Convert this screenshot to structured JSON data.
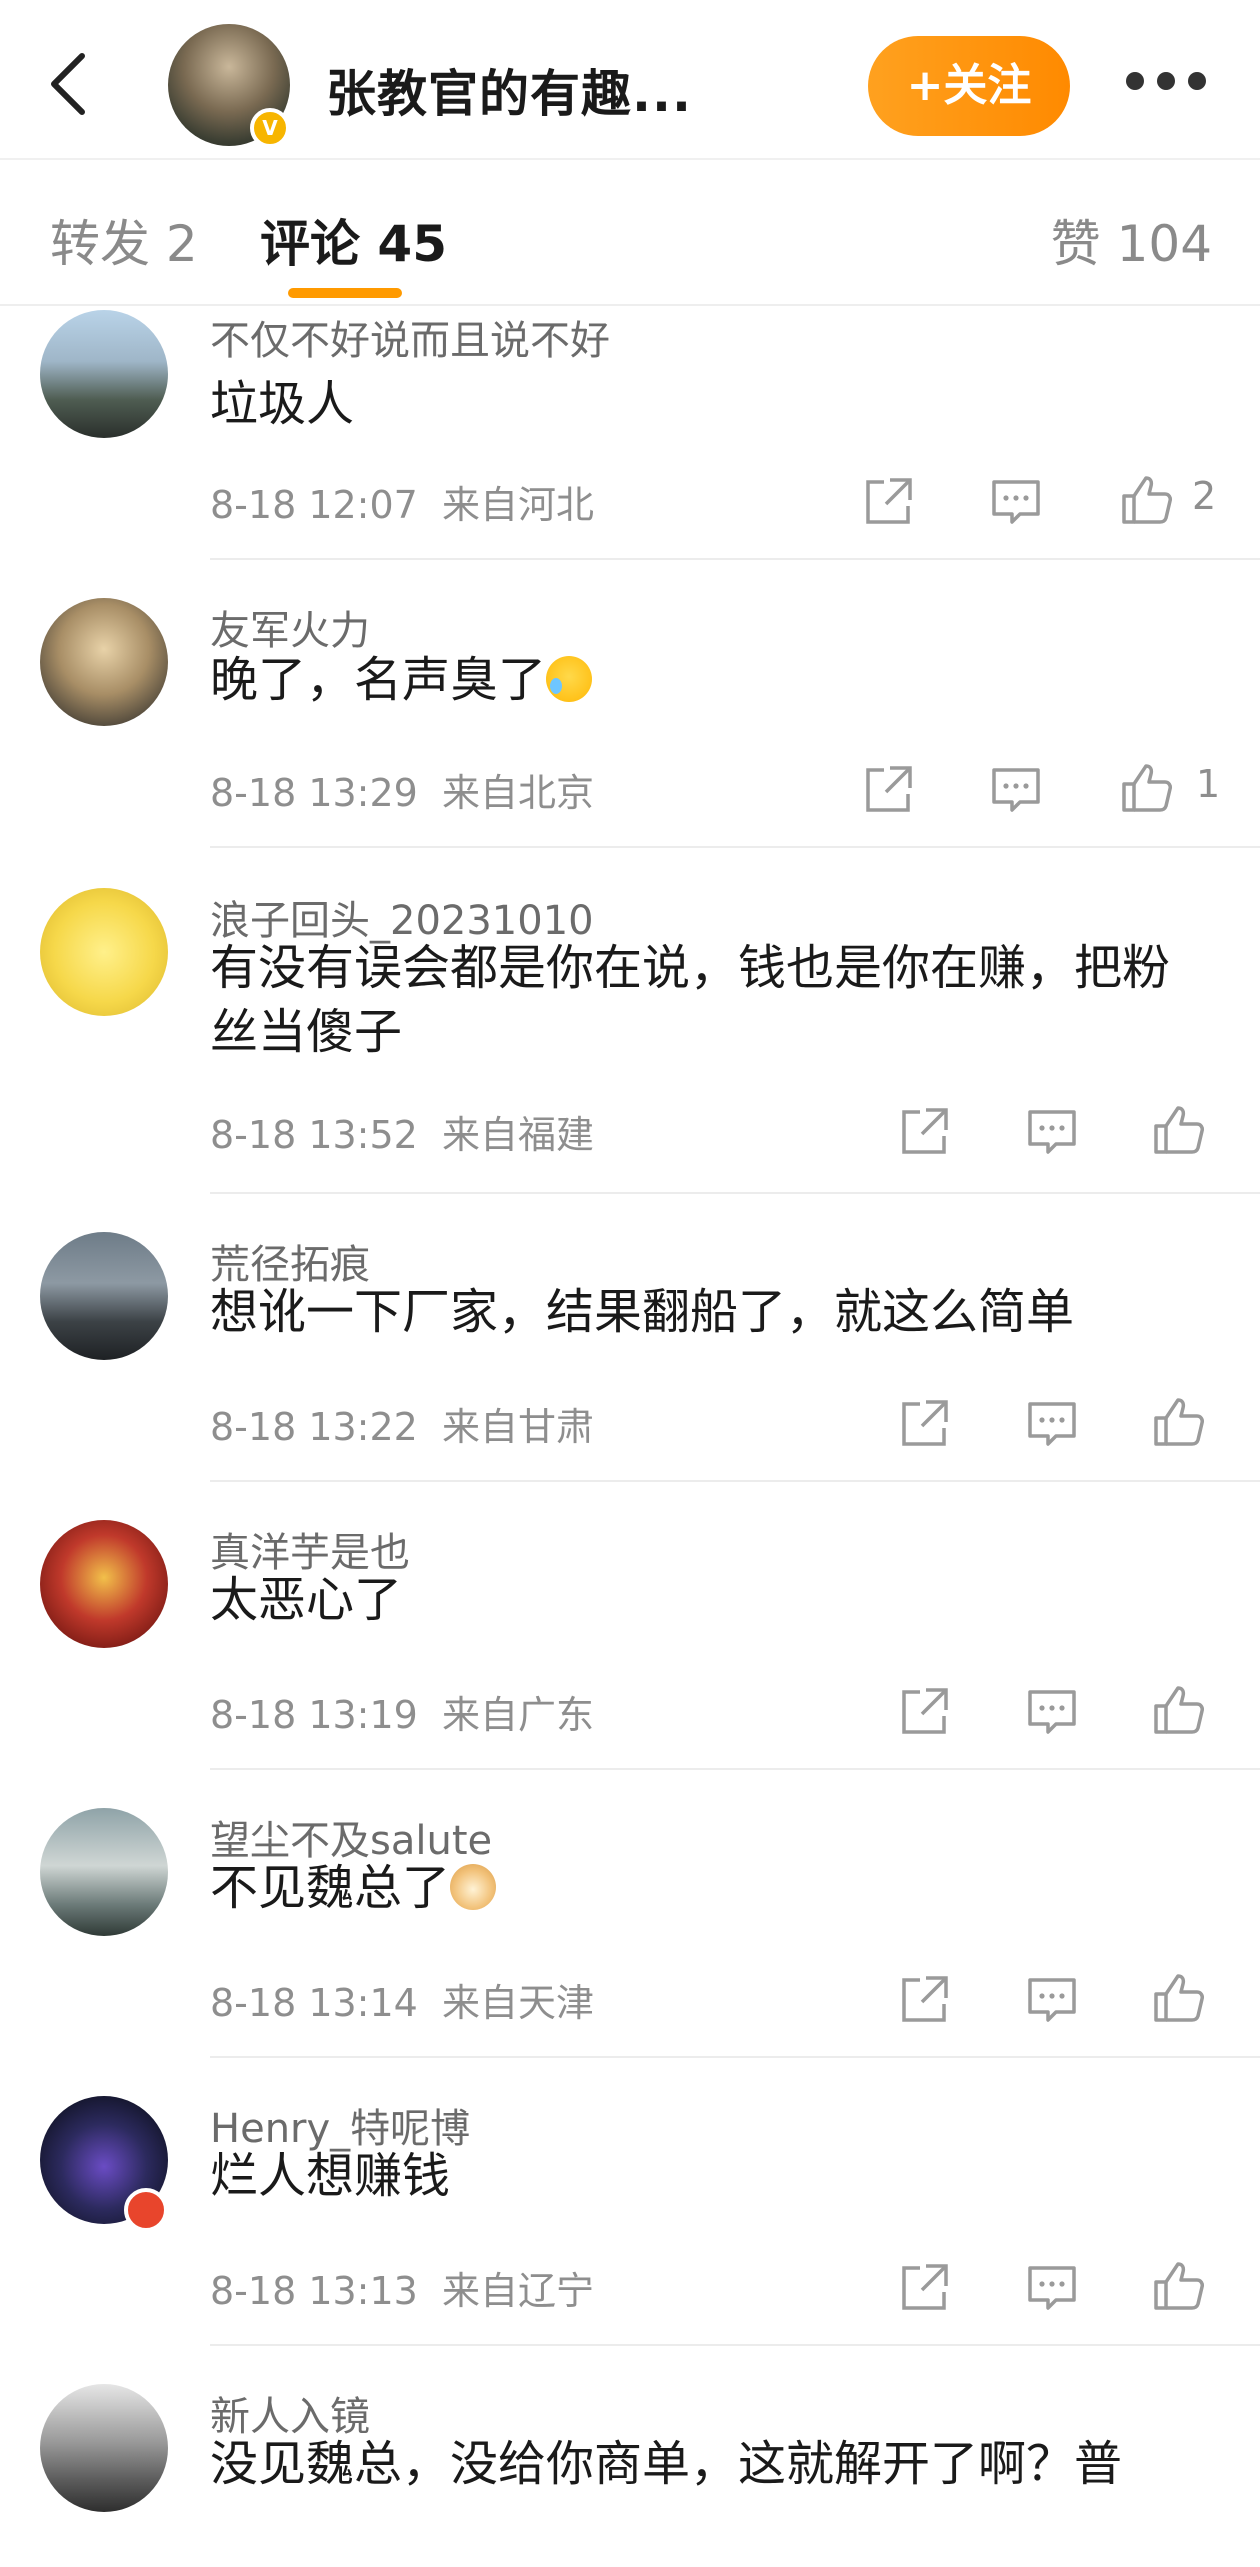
{
  "header": {
    "author_name": "张教官的有趣...",
    "follow_label": "+关注",
    "verified_mark": "V"
  },
  "tabs": [
    {
      "label": "转发 2",
      "active": false
    },
    {
      "label": "评论 45",
      "active": true
    },
    {
      "label": "赞 104",
      "active": false
    }
  ],
  "colors": {
    "accent": "#FF9A00",
    "text_primary": "#1A1A1A",
    "text_secondary": "#8E8E8E"
  },
  "comments": [
    {
      "username": "不仅不好说而且说不好",
      "text": "垃圾人",
      "time": "8-18 12:07",
      "location": "来自河北",
      "likes": "2",
      "emoji": ""
    },
    {
      "username": "友军火力",
      "text": "晚了，名声臭了",
      "time": "8-18 13:29",
      "location": "来自北京",
      "likes": "1",
      "emoji": "laugh-cry"
    },
    {
      "username": "浪子回头_20231010",
      "text": "有没有误会都是你在说，钱也是你在赚，把粉丝当傻子",
      "time": "8-18 13:52",
      "location": "来自福建",
      "likes": "",
      "emoji": ""
    },
    {
      "username": "荒径拓痕",
      "text": "想讹一下厂家，结果翻船了，就这么简单",
      "time": "8-18 13:22",
      "location": "来自甘肃",
      "likes": "",
      "emoji": ""
    },
    {
      "username": "真洋芋是也",
      "text": "太恶心了",
      "time": "8-18 13:19",
      "location": "来自广东",
      "likes": "",
      "emoji": ""
    },
    {
      "username": "望尘不及salute",
      "text": "不见魏总了",
      "time": "8-18 13:14",
      "location": "来自天津",
      "likes": "",
      "emoji": "doge"
    },
    {
      "username": "Henry_特呢博",
      "text": "烂人想赚钱",
      "time": "8-18 13:13",
      "location": "来自辽宁",
      "likes": "",
      "emoji": ""
    },
    {
      "username": "新人入镜",
      "text": "没见魏总，没给你商单，这就解开了啊？普",
      "time": "",
      "location": "",
      "likes": "",
      "emoji": ""
    }
  ]
}
